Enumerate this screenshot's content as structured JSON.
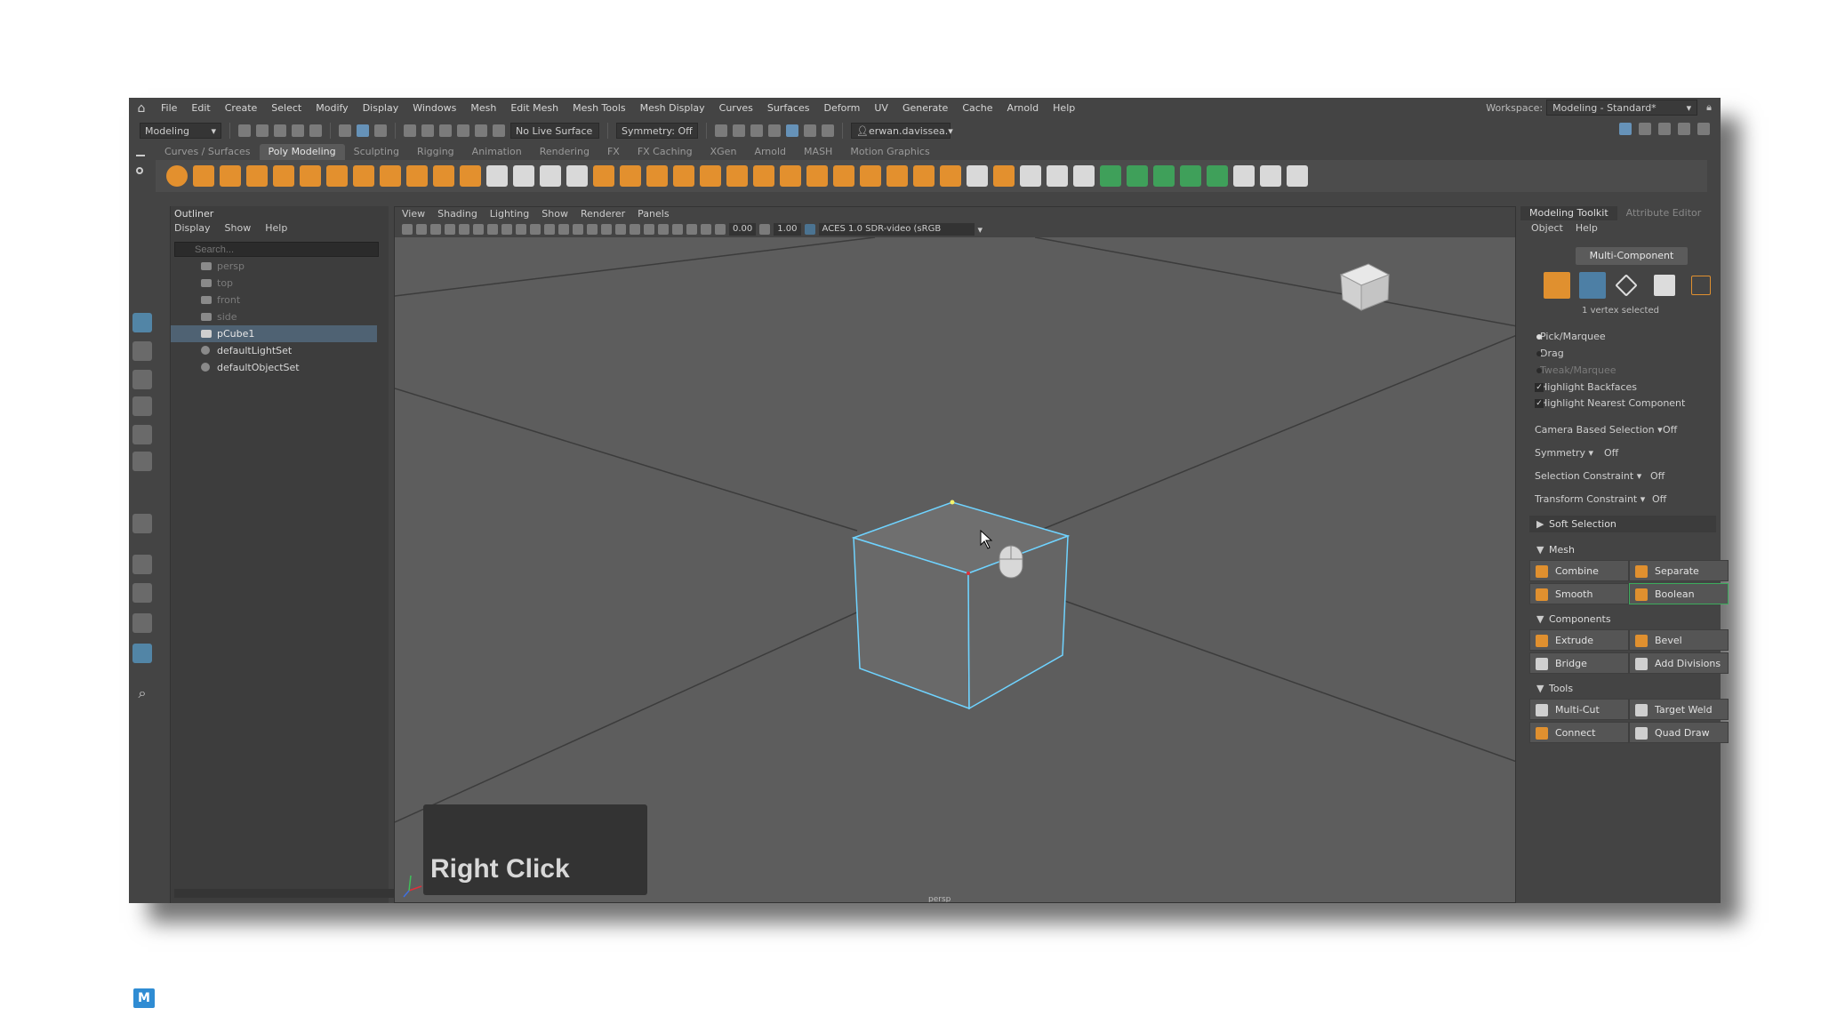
{
  "menubar": {
    "items": [
      "File",
      "Edit",
      "Create",
      "Select",
      "Modify",
      "Display",
      "Windows",
      "Mesh",
      "Edit Mesh",
      "Mesh Tools",
      "Mesh Display",
      "Curves",
      "Surfaces",
      "Deform",
      "UV",
      "Generate",
      "Cache",
      "Arnold",
      "Help"
    ],
    "workspace_label": "Workspace:",
    "workspace_value": "Modeling - Standard*"
  },
  "statusline": {
    "menuset": "Modeling",
    "live_surface": "No Live Surface",
    "symmetry": "Symmetry: Off",
    "user": "erwan.davissea."
  },
  "shelf": {
    "tabs": [
      "Curves / Surfaces",
      "Poly Modeling",
      "Sculpting",
      "Rigging",
      "Animation",
      "Rendering",
      "FX",
      "FX Caching",
      "XGen",
      "Arnold",
      "MASH",
      "Motion Graphics"
    ],
    "active_tab": "Poly Modeling"
  },
  "outliner": {
    "title": "Outliner",
    "menu": [
      "Display",
      "Show",
      "Help"
    ],
    "search_placeholder": "Search...",
    "items": [
      {
        "label": "persp",
        "state": "dim"
      },
      {
        "label": "top",
        "state": "dim"
      },
      {
        "label": "front",
        "state": "dim"
      },
      {
        "label": "side",
        "state": "dim"
      },
      {
        "label": "pCube1",
        "state": "selected"
      },
      {
        "label": "defaultLightSet",
        "state": "normal"
      },
      {
        "label": "defaultObjectSet",
        "state": "normal"
      }
    ]
  },
  "viewport": {
    "menu": [
      "View",
      "Shading",
      "Lighting",
      "Show",
      "Renderer",
      "Panels"
    ],
    "exposure": "0.00",
    "gamma": "1.00",
    "color_space": "ACES 1.0 SDR-video (sRGB",
    "camera": "persp",
    "overlay_text": "Right Click"
  },
  "modeling_toolkit": {
    "tabs": [
      "Modeling Toolkit",
      "Attribute Editor"
    ],
    "menu": [
      "Object",
      "Help"
    ],
    "mode_button": "Multi-Component",
    "selection_info": "1 vertex selected",
    "pick_modes": [
      {
        "label": "Pick/Marquee",
        "on": true,
        "dim": false
      },
      {
        "label": "Drag",
        "on": false,
        "dim": false
      },
      {
        "label": "Tweak/Marquee",
        "on": false,
        "dim": true
      }
    ],
    "checks": [
      "Highlight Backfaces",
      "Highlight Nearest Component"
    ],
    "options": [
      {
        "label": "Camera Based Selection",
        "value": "Off"
      },
      {
        "label": "Symmetry",
        "value": "Off"
      },
      {
        "label": "Selection Constraint",
        "value": "Off"
      },
      {
        "label": "Transform Constraint",
        "value": "Off"
      }
    ],
    "soft_selection": "Soft Selection",
    "sections": {
      "mesh": {
        "title": "Mesh",
        "buttons": [
          "Combine",
          "Separate",
          "Smooth",
          "Boolean"
        ]
      },
      "components": {
        "title": "Components",
        "buttons": [
          "Extrude",
          "Bevel",
          "Bridge",
          "Add Divisions"
        ]
      },
      "tools": {
        "title": "Tools",
        "buttons": [
          "Multi-Cut",
          "Target Weld",
          "Connect",
          "Quad Draw"
        ]
      }
    }
  },
  "logo": "M",
  "colors": {
    "accent": "#e0902f",
    "selection": "#4f6273",
    "highlight_wire": "#6fd3ff"
  }
}
